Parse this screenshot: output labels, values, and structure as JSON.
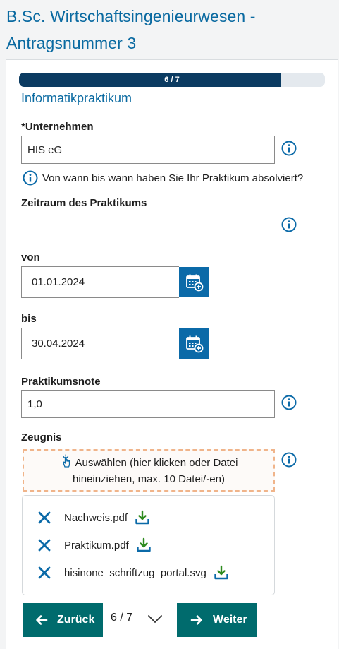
{
  "page": {
    "title_line1": "B.Sc. Wirtschaftsingenieurwesen -",
    "title_line2": "Antragsnummer 3"
  },
  "progress": {
    "label": "6 / 7",
    "current": 6,
    "total": 7
  },
  "section": {
    "title": "Informatikpraktikum"
  },
  "unternehmen": {
    "label": "*Unternehmen",
    "value": "HIS eG"
  },
  "hint": {
    "text": "Von wann bis wann haben Sie Ihr Praktikum absolviert?"
  },
  "zeitraum": {
    "label": "Zeitraum des Praktikums"
  },
  "von": {
    "label": "von",
    "value": "01.01.2024"
  },
  "bis": {
    "label": "bis",
    "value": "30.04.2024"
  },
  "note": {
    "label": "Praktikumsnote",
    "value": "1,0"
  },
  "zeugnis": {
    "label": "Zeugnis",
    "dropzone_line1": "Auswählen (hier klicken oder Datei",
    "dropzone_line2": "hineinziehen, max. 10 Datei/-en)"
  },
  "files": [
    {
      "name": "Nachweis.pdf"
    },
    {
      "name": "Praktikum.pdf"
    },
    {
      "name": "hisinone_schriftzug_portal.svg"
    }
  ],
  "nav": {
    "back_label": "Zurück",
    "next_label": "Weiter",
    "page_indicator": "6 / 7"
  },
  "colors": {
    "primary_blue": "#0b6aa8",
    "title_blue": "#0a6aa1",
    "progress_fill": "#0b3b61",
    "teal_button": "#006b6d",
    "download_green": "#2e8b1f",
    "dropzone_border": "#f0b48a"
  },
  "icons": {
    "info": "info-icon",
    "calendar": "calendar-add-icon",
    "hand": "pointer-hand-icon",
    "remove": "close-icon",
    "download": "download-icon",
    "back": "arrow-left-icon",
    "next": "arrow-right-icon",
    "pager": "chevron-down-icon"
  }
}
